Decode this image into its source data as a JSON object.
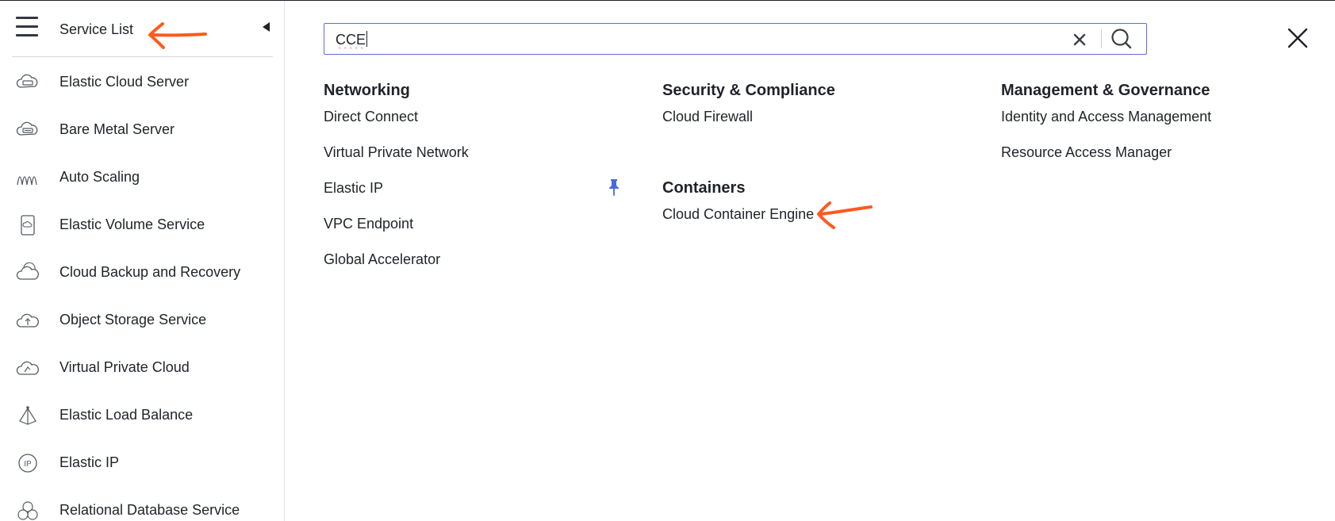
{
  "sidebar": {
    "title": "Service List",
    "items": [
      {
        "label": "Elastic Cloud Server",
        "icon": "server-cloud-icon"
      },
      {
        "label": "Bare Metal Server",
        "icon": "bare-metal-cloud-icon"
      },
      {
        "label": "Auto Scaling",
        "icon": "auto-scaling-icon"
      },
      {
        "label": "Elastic Volume Service",
        "icon": "volume-icon"
      },
      {
        "label": "Cloud Backup and Recovery",
        "icon": "backup-cloud-icon"
      },
      {
        "label": "Object Storage Service",
        "icon": "storage-cloud-icon"
      },
      {
        "label": "Virtual Private Cloud",
        "icon": "vpc-cloud-icon"
      },
      {
        "label": "Elastic Load Balance",
        "icon": "load-balance-icon"
      },
      {
        "label": "Elastic IP",
        "icon": "ip-icon"
      },
      {
        "label": "Relational Database Service",
        "icon": "database-icon"
      }
    ]
  },
  "search": {
    "value": "CCE",
    "placeholder": ""
  },
  "categories": {
    "networking": {
      "title": "Networking",
      "links": [
        "Direct Connect",
        "Virtual Private Network",
        "Elastic IP",
        "VPC Endpoint",
        "Global Accelerator"
      ]
    },
    "security": {
      "title": "Security & Compliance",
      "links": [
        "Cloud Firewall"
      ]
    },
    "containers": {
      "title": "Containers",
      "links": [
        "Cloud Container Engine"
      ]
    },
    "management": {
      "title": "Management & Governance",
      "links": [
        "Identity and Access Management",
        "Resource Access Manager"
      ]
    }
  },
  "colors": {
    "accent": "#5a6fd6",
    "pin": "#4a68d9",
    "annotation": "#ff5a1f",
    "text": "#1f2329"
  }
}
